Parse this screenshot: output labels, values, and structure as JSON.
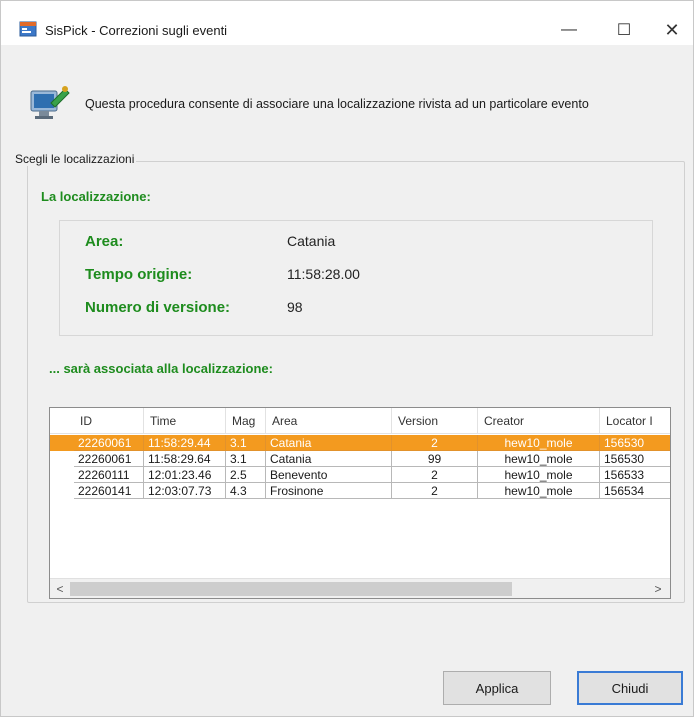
{
  "window": {
    "title": "SisPick - Correzioni sugli eventi",
    "minimize_glyph": "—",
    "maximize_glyph": "☐",
    "close_glyph": "✕"
  },
  "intro": {
    "text": "Questa procedura consente di associare una localizzazione rivista ad un particolare evento",
    "icon": "computer-satellite-icon"
  },
  "group": {
    "legend": "Scegli le localizzazioni",
    "location_heading": "La localizzazione:",
    "association_heading": "... sarà associata alla localizzazione:"
  },
  "location": {
    "area_label": "Area:",
    "area_value": "Catania",
    "origin_time_label": "Tempo origine:",
    "origin_time_value": "11:58:28.00",
    "version_label": "Numero di versione:",
    "version_value": "98"
  },
  "table": {
    "columns": [
      "ID",
      "Time",
      "Mag",
      "Area",
      "Version",
      "Creator",
      "Locator I"
    ],
    "rows": [
      {
        "id": "22260061",
        "time": "11:58:29.44",
        "mag": "3.1",
        "area": "Catania",
        "version": "2",
        "creator": "hew10_mole",
        "locator": "156530",
        "selected": true
      },
      {
        "id": "22260061",
        "time": "11:58:29.64",
        "mag": "3.1",
        "area": "Catania",
        "version": "99",
        "creator": "hew10_mole",
        "locator": "156530",
        "selected": false
      },
      {
        "id": "22260111",
        "time": "12:01:23.46",
        "mag": "2.5",
        "area": "Benevento",
        "version": "2",
        "creator": "hew10_mole",
        "locator": "156533",
        "selected": false
      },
      {
        "id": "22260141",
        "time": "12:03:07.73",
        "mag": "4.3",
        "area": "Frosinone",
        "version": "2",
        "creator": "hew10_mole",
        "locator": "156534",
        "selected": false
      }
    ],
    "scroll_left": "<",
    "scroll_right": ">"
  },
  "buttons": {
    "apply": "Applica",
    "close": "Chiudi"
  },
  "colors": {
    "accent_green": "#1e8c1e",
    "selection_orange": "#f39a1f",
    "default_button_border": "#3a7bd5"
  }
}
